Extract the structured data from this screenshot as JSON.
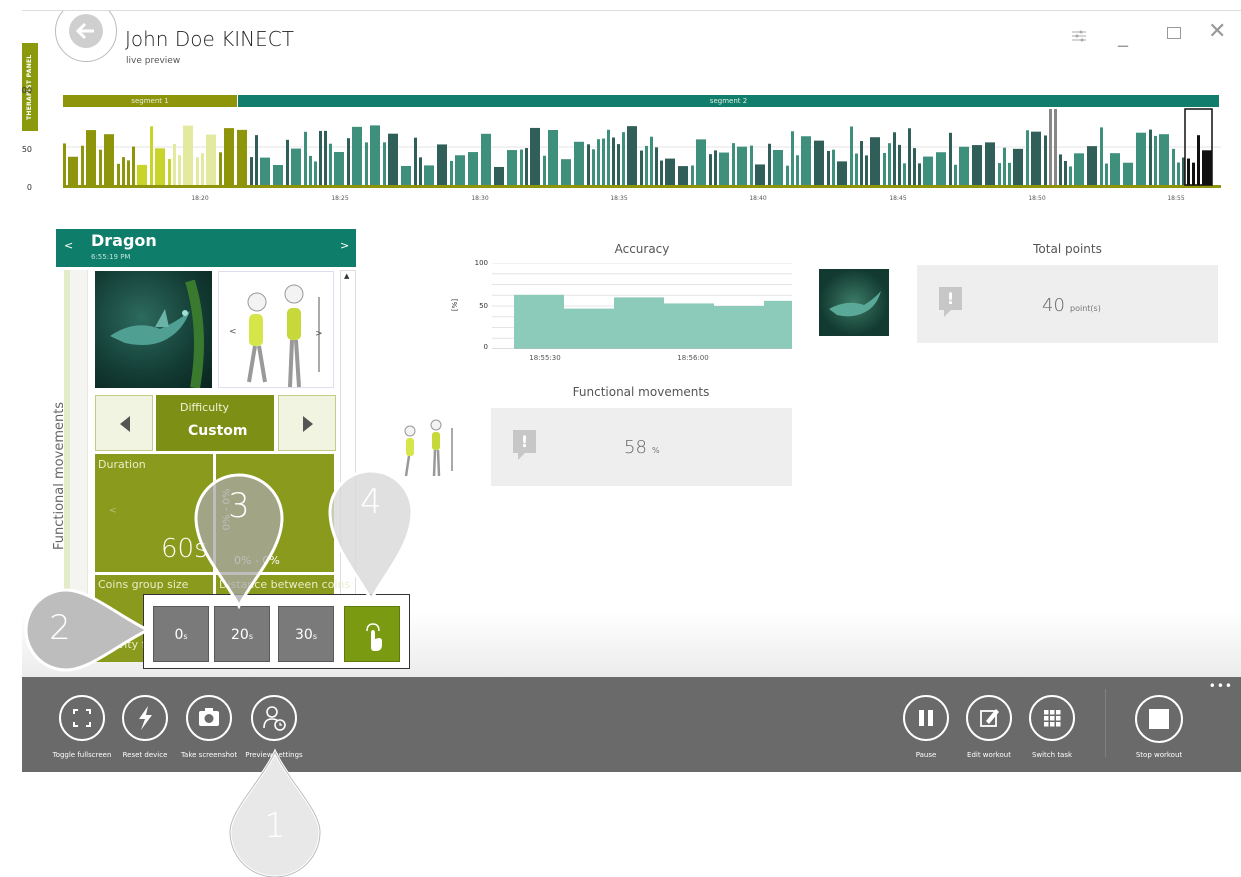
{
  "header": {
    "title": "John Doe KINECT",
    "subtitle": "live preview",
    "therapist_tab": "THERAPIST PANEL"
  },
  "timeline": {
    "segments": [
      {
        "label": "segment 1"
      },
      {
        "label": "segment 2"
      }
    ],
    "y_ticks": [
      "100",
      "50",
      "0"
    ],
    "x_ticks": [
      "18:20",
      "18:25",
      "18:30",
      "18:35",
      "18:40",
      "18:45",
      "18:50",
      "18:55"
    ]
  },
  "task": {
    "name": "Dragon",
    "time": "6:55:19 PM",
    "prev": "<",
    "next": ">",
    "side_label": "Functional movements",
    "difficulty_label": "Difficulty",
    "difficulty_value": "Custom",
    "duration_label": "Duration",
    "duration_value": "60s",
    "range_value": "0% - 0%",
    "range_vertical": "0% - 0%",
    "coins_label": "Coins group size",
    "distance_label": "Distance between coins",
    "gravity_label": "Gravity f"
  },
  "accuracy": {
    "title": "Accuracy",
    "y_ticks": [
      "100",
      "50",
      "0"
    ],
    "y_unit": "[%]",
    "x_ticks": [
      "18:55:30",
      "18:56:00"
    ]
  },
  "chart_data": {
    "type": "bar",
    "title": "Accuracy",
    "ylabel": "[%]",
    "ylim": [
      0,
      100
    ],
    "xlabel": "",
    "values": [
      63,
      47,
      60,
      53,
      50,
      56
    ]
  },
  "functional": {
    "title": "Functional movements",
    "value": "58",
    "unit": "%"
  },
  "total_points": {
    "title": "Total points",
    "value": "40",
    "unit": "point(s)"
  },
  "toolbar": {
    "left": [
      "Toggle fullscreen",
      "Reset device",
      "Take screenshot",
      "Preview settings"
    ],
    "right": [
      "Pause",
      "Edit workout",
      "Switch task",
      "Stop workout"
    ],
    "more": "•••"
  },
  "popup": {
    "options": [
      {
        "value": "0",
        "unit": "s"
      },
      {
        "value": "20",
        "unit": "s"
      },
      {
        "value": "30",
        "unit": "s"
      }
    ]
  },
  "callouts": [
    "1",
    "2",
    "3",
    "4"
  ],
  "colors": {
    "teal": "#0e7e6a",
    "olive": "#8a9a0c",
    "toolbar": "#6a6a6a",
    "accent_green": "#7a9a12"
  }
}
